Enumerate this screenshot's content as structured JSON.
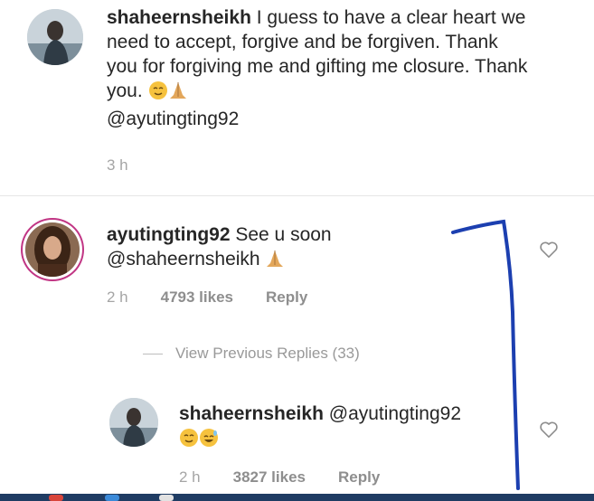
{
  "comments": [
    {
      "username": "shaheernsheikh",
      "text": " I guess to have a clear heart we need to accept, forgive and be forgiven. Thank you for forgiving me and gifting me closure. Thank you. ",
      "mention": "@ayutingting92",
      "time": "3 h"
    },
    {
      "username": "ayutingting92",
      "text": " See u soon",
      "mention": "@shaheernsheikh",
      "time": "2 h",
      "likes": "4793 likes",
      "reply_label": "Reply"
    }
  ],
  "view_previous_replies": "View Previous Replies (33)",
  "reply": {
    "username": "shaheernsheikh",
    "mention": "@ayutingting92",
    "time": "2 h",
    "likes": "3827 likes",
    "reply_label": "Reply"
  },
  "icons": {
    "heart": "heart-outline-icon",
    "emoji_relieved": "relieved-face-emoji",
    "emoji_pray": "folded-hands-emoji",
    "emoji_sweat": "grinning-sweat-emoji"
  },
  "colors": {
    "text": "#262626",
    "meta": "#8e8e8e",
    "story_ring": "#c13584",
    "annotation": "#1c3fb0",
    "taskbar": "#1f3c63"
  }
}
